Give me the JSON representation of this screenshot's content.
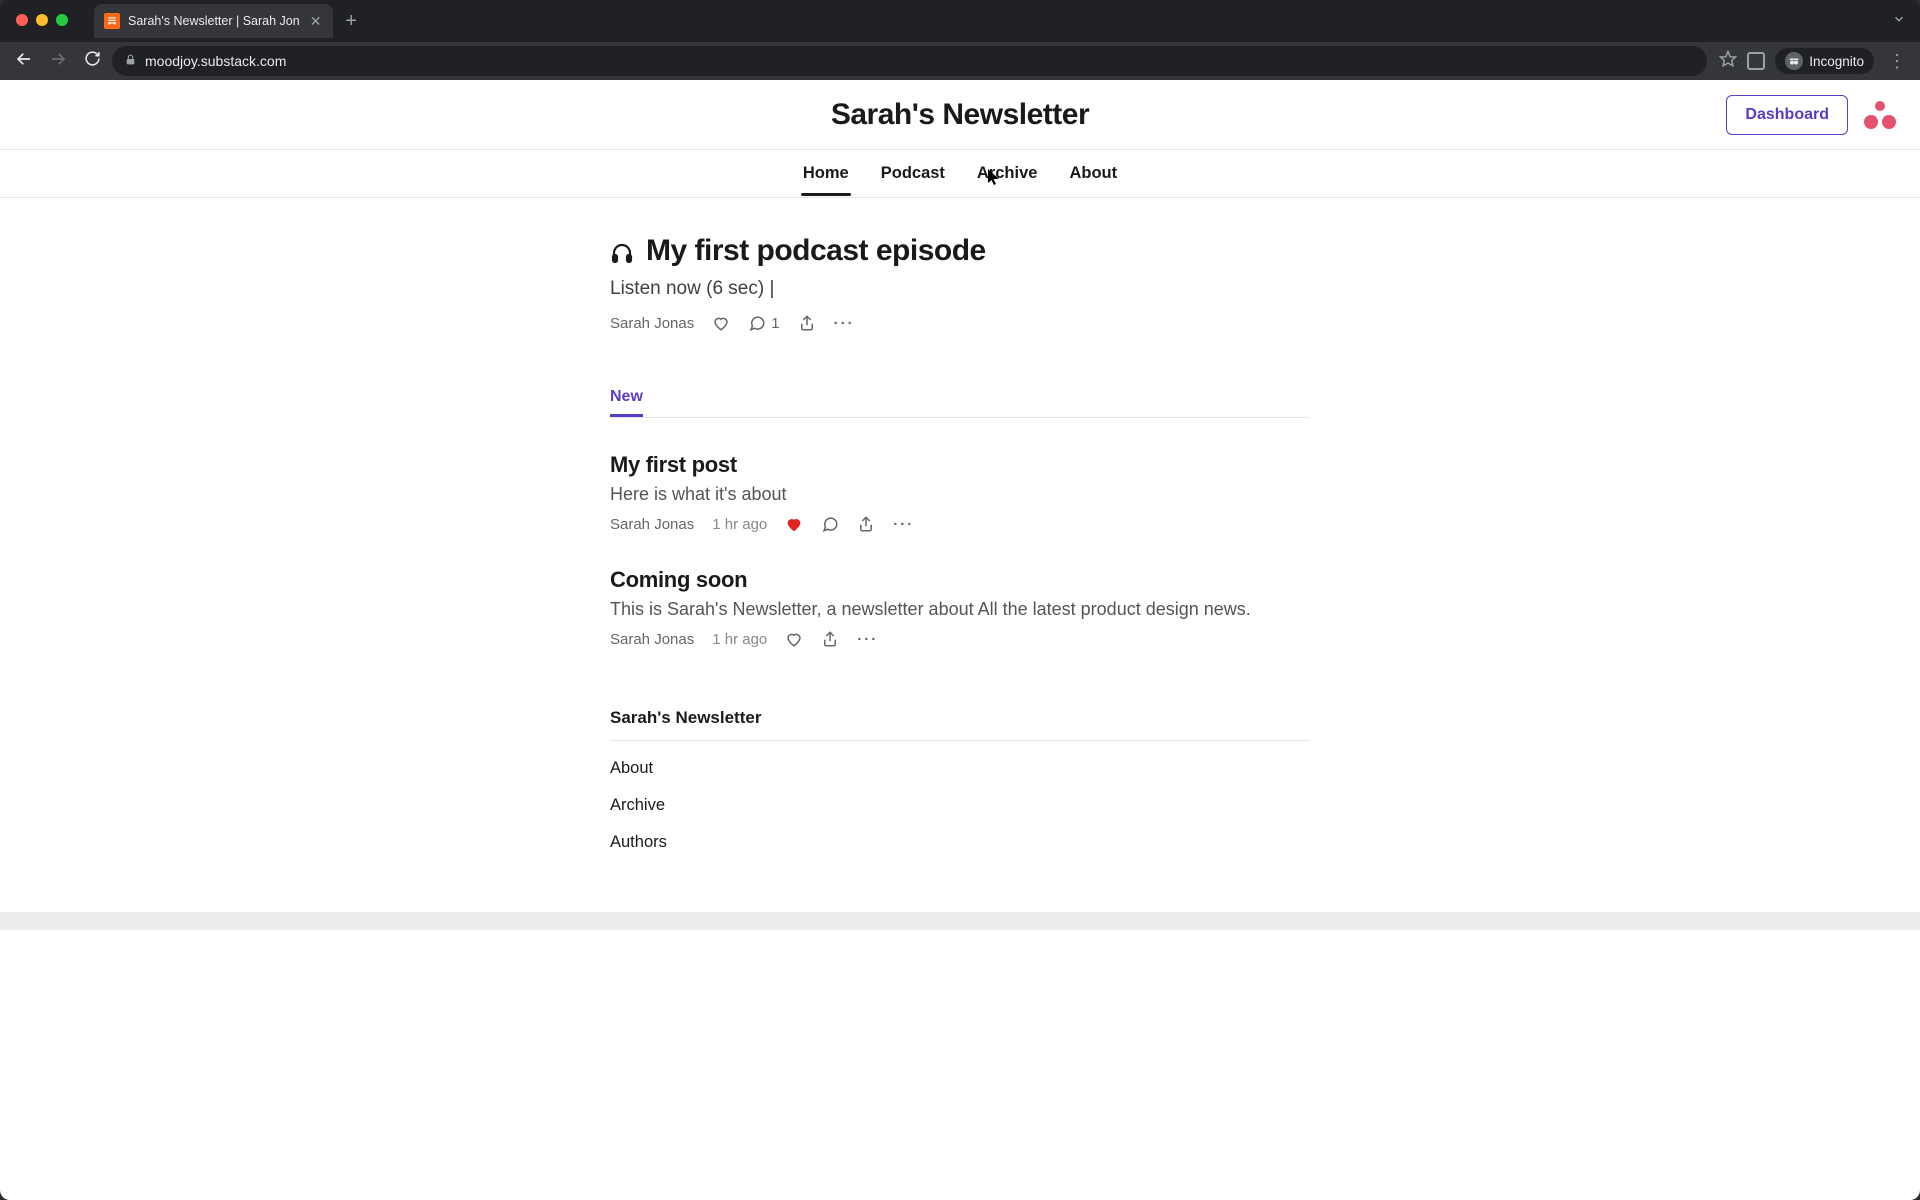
{
  "browser": {
    "tab_title": "Sarah's Newsletter | Sarah Jon",
    "url": "moodjoy.substack.com",
    "incognito_label": "Incognito"
  },
  "header": {
    "site_title": "Sarah's Newsletter",
    "dashboard_label": "Dashboard"
  },
  "nav": {
    "items": [
      "Home",
      "Podcast",
      "Archive",
      "About"
    ],
    "active_index": 0
  },
  "featured": {
    "title": "My first podcast episode",
    "subtitle": "Listen now (6 sec) |",
    "author": "Sarah Jonas",
    "comment_count": "1"
  },
  "subnav": {
    "label": "New"
  },
  "posts": [
    {
      "title": "My first post",
      "desc": "Here is what it's about",
      "author": "Sarah Jonas",
      "time": "1 hr ago",
      "liked": true,
      "has_comment_icon": true
    },
    {
      "title": "Coming soon",
      "desc": "This is Sarah's Newsletter, a newsletter about All the latest product design news.",
      "author": "Sarah Jonas",
      "time": "1 hr ago",
      "liked": false,
      "has_comment_icon": false
    }
  ],
  "footer": {
    "title": "Sarah's Newsletter",
    "links": [
      "About",
      "Archive",
      "Authors"
    ]
  }
}
